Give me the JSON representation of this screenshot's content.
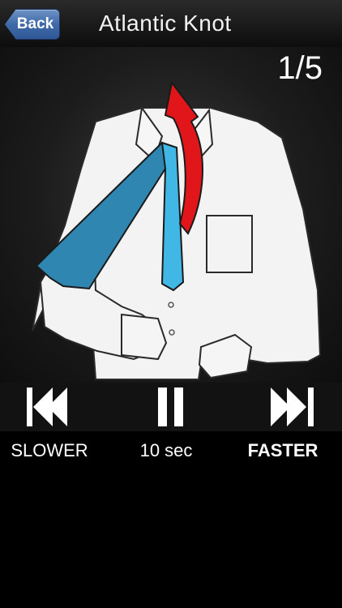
{
  "navbar": {
    "back_label": "Back",
    "title": "Atlantic Knot"
  },
  "stage": {
    "step": "1/5"
  },
  "controls": {
    "slower_label": "SLOWER",
    "interval_label": "10 sec",
    "faster_label": "FASTER",
    "slower_icon": "skip-back-icon",
    "pause_icon": "pause-icon",
    "faster_icon": "skip-forward-icon"
  },
  "colors": {
    "tie": "#2f86b1",
    "tie_light": "#41b7e6",
    "arrow": "#e0161a",
    "shirt": "#f3f3f3"
  }
}
